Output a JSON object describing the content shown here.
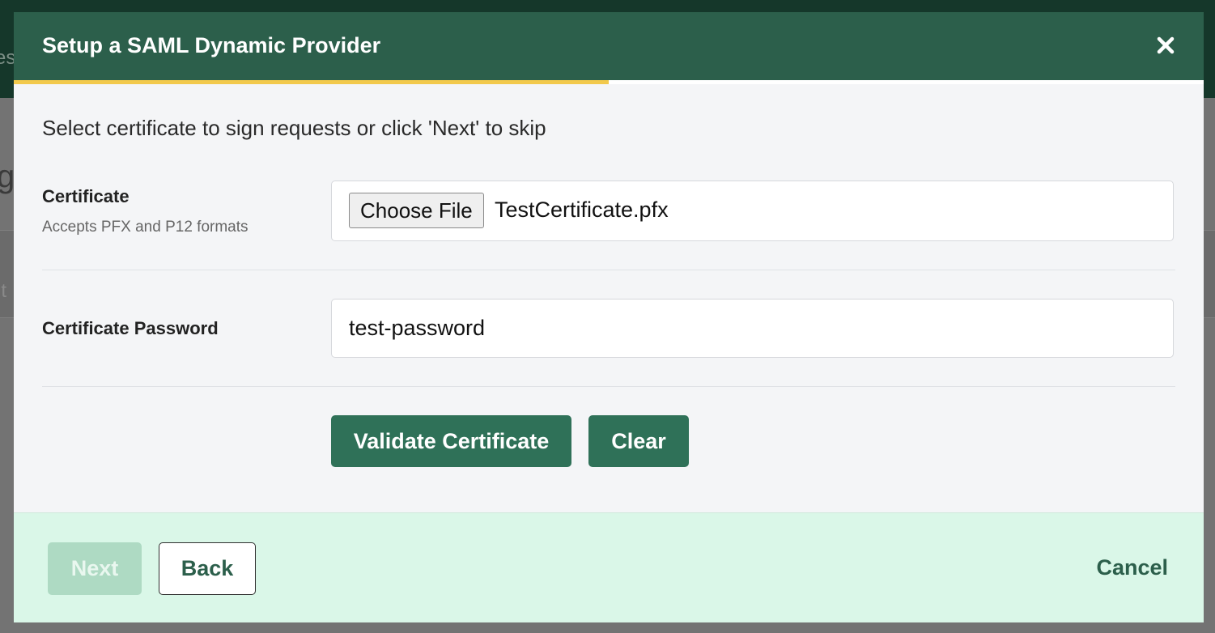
{
  "background": {
    "edge_fragment_1": "es",
    "edge_fragment_2": "g",
    "edge_fragment_3": "it"
  },
  "modal": {
    "title": "Setup a SAML Dynamic Provider",
    "close_icon": "close-icon",
    "progress_fraction": 0.5,
    "instruction": "Select certificate to sign requests or click 'Next' to skip",
    "certificate": {
      "label": "Certificate",
      "hint": "Accepts PFX and P12 formats",
      "choose_file_label": "Choose File",
      "file_name": "TestCertificate.pfx"
    },
    "password": {
      "label": "Certificate Password",
      "value": "test-password"
    },
    "actions": {
      "validate_label": "Validate Certificate",
      "clear_label": "Clear"
    },
    "footer": {
      "next_label": "Next",
      "back_label": "Back",
      "cancel_label": "Cancel"
    }
  },
  "colors": {
    "header": "#2c5f4b",
    "accent_progress": "#f2c94c",
    "primary_button": "#2f7158",
    "footer_bg": "#daf7e8"
  }
}
